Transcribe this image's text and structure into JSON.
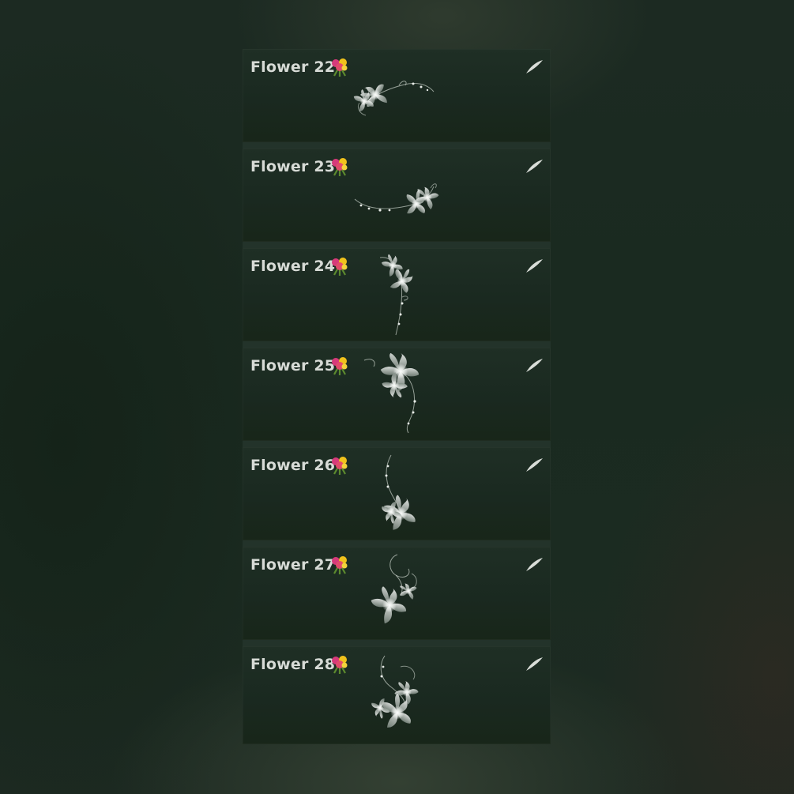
{
  "brushes": [
    {
      "name": "Flower 22",
      "icon": "bouquet-icon",
      "action_icon": "brush-stroke-icon"
    },
    {
      "name": "Flower 23",
      "icon": "bouquet-icon",
      "action_icon": "brush-stroke-icon"
    },
    {
      "name": "Flower 24",
      "icon": "bouquet-icon",
      "action_icon": "brush-stroke-icon"
    },
    {
      "name": "Flower 25",
      "icon": "bouquet-icon",
      "action_icon": "brush-stroke-icon"
    },
    {
      "name": "Flower 26",
      "icon": "bouquet-icon",
      "action_icon": "brush-stroke-icon"
    },
    {
      "name": "Flower 27",
      "icon": "bouquet-icon",
      "action_icon": "brush-stroke-icon"
    },
    {
      "name": "Flower 28",
      "icon": "bouquet-icon",
      "action_icon": "brush-stroke-icon"
    }
  ],
  "colors": {
    "background": "#1a2a20",
    "item_background": "#1c2c22",
    "text": "#d7dbd6",
    "flower": "#e8ece8"
  }
}
